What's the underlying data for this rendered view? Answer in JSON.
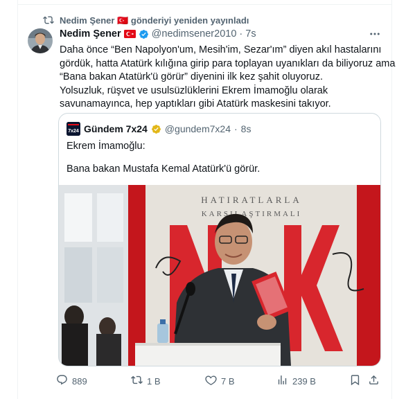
{
  "repost": {
    "icon": "repost-icon",
    "text": "Nedim Şener 🇹🇷 gönderiyi yeniden yayınladı"
  },
  "tweet": {
    "author_name": "Nedim Şener",
    "handle": "@nedimsener2010",
    "separator": "·",
    "time": "7s",
    "lines": [
      "Daha önce “Ben Napolyon'um, Mesih'im, Sezar'ım” diyen akıl hastalarını",
      "gördük, hatta Atatürk kılığına girip para toplayan uyanıkları da biliyoruz ama",
      "“Bana bakan Atatürk'ü görür” diyenini ilk kez şahit oluyoruz.",
      "Yolsuzluk, rüşvet ve usulsüzlüklerini Ekrem İmamoğlu olarak",
      "savunamayınca, hep yaptıkları gibi Atatürk maskesini takıyor."
    ]
  },
  "quote": {
    "author_name": "Gündem 7x24",
    "handle": "@gundem7x24",
    "separator": "·",
    "time": "8s",
    "line1": "Ekrem İmamoğlu:",
    "line2": "Bana bakan Mustafa Kemal Atatürk'ü görür.",
    "avatar_text": "7x24",
    "image_banner_line1": "HATIRATLARLA",
    "image_banner_line2": "KARŞILAŞTIRMALI"
  },
  "actions": {
    "replies": "889",
    "reposts": "1 B",
    "likes": "7 B",
    "views": "239 B"
  },
  "colors": {
    "muted": "#536471",
    "verified_blue": "#1d9bf0",
    "verified_gold": "#e2b719",
    "flag_red": "#e30a17",
    "border": "#cfd9de"
  }
}
